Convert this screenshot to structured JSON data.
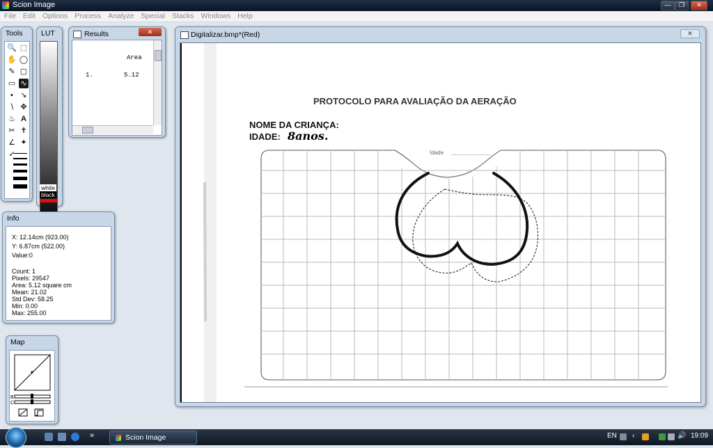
{
  "app": {
    "title": "Scion Image"
  },
  "menu": [
    "File",
    "Edit",
    "Options",
    "Process",
    "Analyze",
    "Special",
    "Stacks",
    "Windows",
    "Help"
  ],
  "tools_palette": {
    "title": "Tools"
  },
  "lut_palette": {
    "title": "LUT",
    "white_label": "white",
    "black_label": "black"
  },
  "results": {
    "title": "Results",
    "column_header": "Area",
    "rows": [
      {
        "index": "1.",
        "area": "5.12"
      }
    ]
  },
  "info": {
    "title": "Info",
    "x": "X: 12.14cm (923.00)",
    "y": "Y: 6.87cm (522.00)",
    "value": "Value:0",
    "count": "Count: 1",
    "pixels": "Pixels: 29547",
    "area": "Area: 5.12 square cm",
    "mean": "Mean: 21.02",
    "std_dev": "Std Dev: 58.25",
    "min": "Min: 0.00",
    "max": "Max: 255.00"
  },
  "map": {
    "title": "Map"
  },
  "image_window": {
    "title": "Digitalizar.bmp*(Red)",
    "document": {
      "heading": "PROTOCOLO PARA AVALIAÇÃO DA AERAÇÃO",
      "child_name_label": "NOME DA CRIANÇA:",
      "age_label": "IDADE:",
      "age_handwritten": "8anos.",
      "idade_field": "Idade"
    }
  },
  "taskbar": {
    "task_label": "Scion Image",
    "language": "EN",
    "clock": "19:09"
  }
}
